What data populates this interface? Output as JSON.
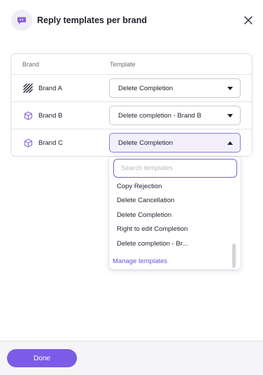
{
  "header": {
    "title": "Reply templates per brand"
  },
  "table": {
    "columns": {
      "brand": "Brand",
      "template": "Template"
    },
    "rows": [
      {
        "brand": "Brand A",
        "template": "Delete Completion",
        "icon": "slash-logo-icon"
      },
      {
        "brand": "Brand B",
        "template": "Delete completion - Brand B",
        "icon": "cube-icon"
      },
      {
        "brand": "Brand C",
        "template": "Delete Completion",
        "icon": "cube-icon"
      }
    ]
  },
  "dropdown": {
    "search_placeholder": "Search templates",
    "options": [
      "Copy Rejection",
      "Delete Cancellation",
      "Delete Completion",
      "Right to edit Completion",
      "Delete completion - Br..."
    ],
    "manage_link": "Manage templates"
  },
  "footer": {
    "done_label": "Done"
  },
  "colors": {
    "accent": "#7c5be6",
    "link": "#6c4fd6",
    "focus_border": "#7a63d6",
    "icon_purple": "#8a6ad8"
  }
}
